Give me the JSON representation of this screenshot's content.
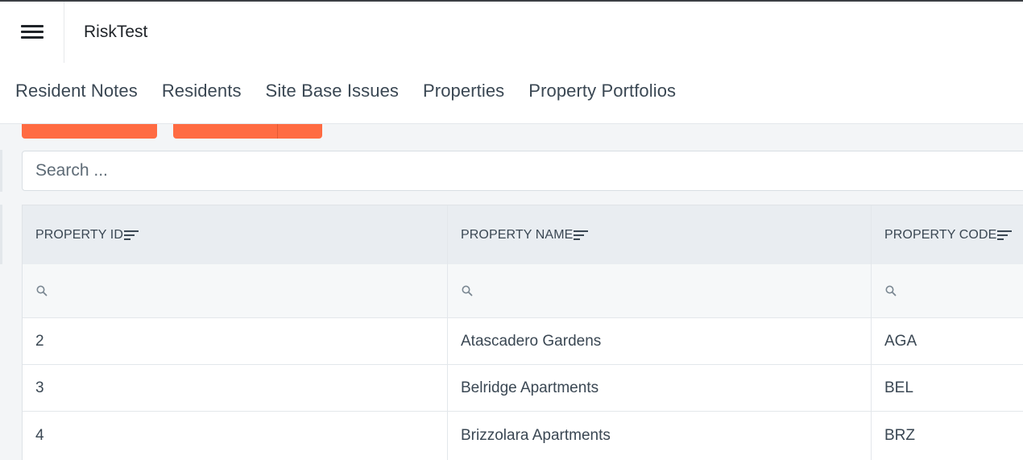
{
  "app": {
    "title": "RiskTest"
  },
  "nav": {
    "items": [
      {
        "label": "Resident Notes"
      },
      {
        "label": "Residents"
      },
      {
        "label": "Site Base Issues"
      },
      {
        "label": "Properties"
      },
      {
        "label": "Property Portfolios"
      }
    ]
  },
  "search": {
    "placeholder": "Search ...",
    "value": ""
  },
  "table": {
    "columns": [
      {
        "label": "PROPERTY ID"
      },
      {
        "label": "PROPERTY NAME"
      },
      {
        "label": "PROPERTY CODE"
      }
    ],
    "rows": [
      {
        "id": "2",
        "name": "Atascadero Gardens",
        "code": "AGA"
      },
      {
        "id": "3",
        "name": "Belridge Apartments",
        "code": "BEL"
      },
      {
        "id": "4",
        "name": "Brizzolara Apartments",
        "code": "BRZ"
      }
    ]
  },
  "icons": {
    "menu": "hamburger-menu-icon",
    "sort": "sort-lines-icon",
    "filter": "magnifier-icon"
  },
  "colors": {
    "accent": "#ff6b42",
    "header_bg": "#e9edf1",
    "text": "#3a4753"
  }
}
